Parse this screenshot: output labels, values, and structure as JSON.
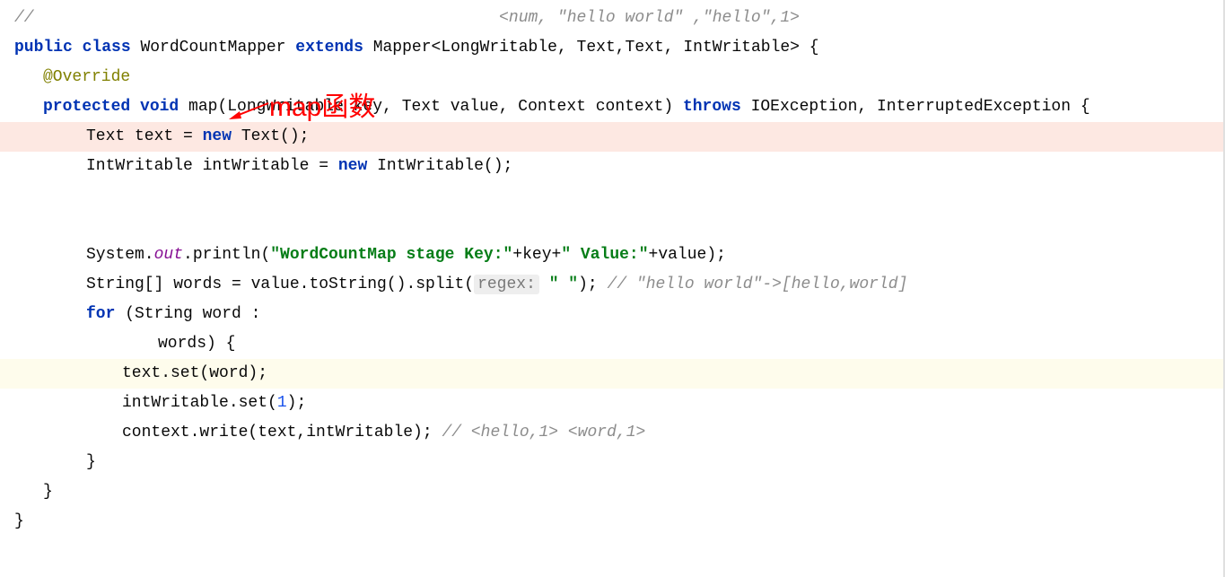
{
  "lines": {
    "l1_comment": "//                                                <num, \"hello world\" ,\"hello\",1>",
    "l2": {
      "p1": "public",
      "p2": " ",
      "p3": "class",
      "p4": " WordCountMapper ",
      "p5": "extends",
      "p6": " Mapper<LongWritable, Text,Text, IntWritable> {"
    },
    "l3": "@Override",
    "l4": {
      "p1": "protected",
      "p2": " ",
      "p3": "void",
      "p4": " map(LongWritable key, Text value, Context context) ",
      "p5": "throws",
      "p6": " IOException, InterruptedException {"
    },
    "l5": {
      "p1": "Text text = ",
      "p2": "new",
      "p3": " Text();"
    },
    "l6": {
      "p1": "IntWritable intWritable = ",
      "p2": "new",
      "p3": " IntWritable();"
    },
    "l7": {
      "p1": "System.",
      "p2": "out",
      "p3": ".println(",
      "p4": "\"WordCountMap stage Key:\"",
      "p5": "+key+",
      "p6": "\" Value:\"",
      "p7": "+value);"
    },
    "l8": {
      "p1": "String[] words = value.toString().split(",
      "p2": "regex:",
      "p3": " ",
      "p4": "\" \"",
      "p5": "); ",
      "p6": "// \"hello world\"->[hello,world]"
    },
    "l9": {
      "p1": "for",
      "p2": " (String word :"
    },
    "l10": "words) {",
    "l11": "text.set(word);",
    "l12": {
      "p1": "intWritable.set(",
      "p2": "1",
      "p3": ");"
    },
    "l13": {
      "p1": "context.write(text,intWritable); ",
      "p2": "// <hello,1> <word,1>"
    },
    "l14": "}",
    "l15": "}",
    "l16": "}"
  },
  "annotation": {
    "text": "map函数"
  }
}
